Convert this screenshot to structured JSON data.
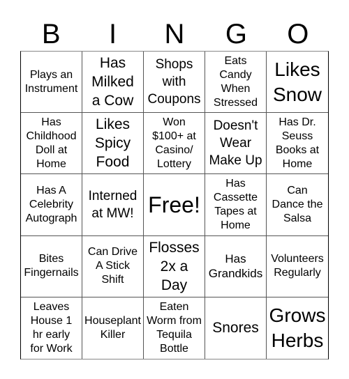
{
  "header": {
    "letters": [
      "B",
      "I",
      "N",
      "G",
      "O"
    ]
  },
  "cells": [
    [
      "Plays an\nInstrument",
      "Has\nMilked\na Cow",
      "Shops\nwith\nCoupons",
      "Eats\nCandy\nWhen\nStressed",
      "Likes\nSnow"
    ],
    [
      "Has\nChildhood\nDoll at\nHome",
      "Likes\nSpicy\nFood",
      "Won\n$100+ at\nCasino/\nLottery",
      "Doesn't\nWear\nMake Up",
      "Has Dr.\nSeuss\nBooks at\nHome"
    ],
    [
      "Has A\nCelebrity\nAutograph",
      "Interned\nat MW!",
      "Free!",
      "Has\nCassette\nTapes at\nHome",
      "Can\nDance the\nSalsa"
    ],
    [
      "Bites\nFingernails",
      "Can Drive\nA Stick\nShift",
      "Flosses\n2x a\nDay",
      "Has\nGrandkids",
      "Volunteers\nRegularly"
    ],
    [
      "Leaves\nHouse 1\nhr early\nfor Work",
      "Houseplant\nKiller",
      "Eaten\nWorm from\nTequila\nBottle",
      "Snores",
      "Grows\nHerbs"
    ]
  ]
}
